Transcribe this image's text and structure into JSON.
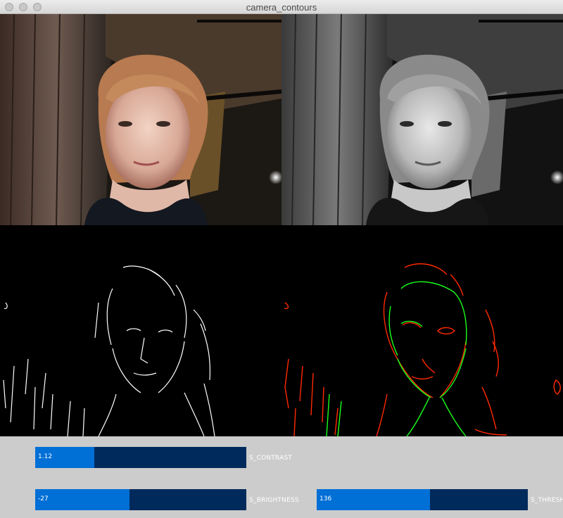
{
  "window": {
    "title": "camera_contours"
  },
  "views": [
    {
      "name": "color-camera"
    },
    {
      "name": "grayscale"
    },
    {
      "name": "edges"
    },
    {
      "name": "contours"
    }
  ],
  "controls": [
    {
      "label": "S_CONTRAST",
      "value_text": "1.12",
      "fraction": 0.28
    },
    {
      "label": "S_BRIGHTNESS",
      "value_text": "-27",
      "fraction": 0.445
    },
    {
      "label": "S_THRESHOLD",
      "value_text": "136",
      "fraction": 0.535
    }
  ],
  "colors": {
    "slider_fill": "#006fd6",
    "slider_track": "#002a5c",
    "background": "#cccccc",
    "contour_red": "#ff2a00",
    "contour_green": "#19ff1a"
  }
}
